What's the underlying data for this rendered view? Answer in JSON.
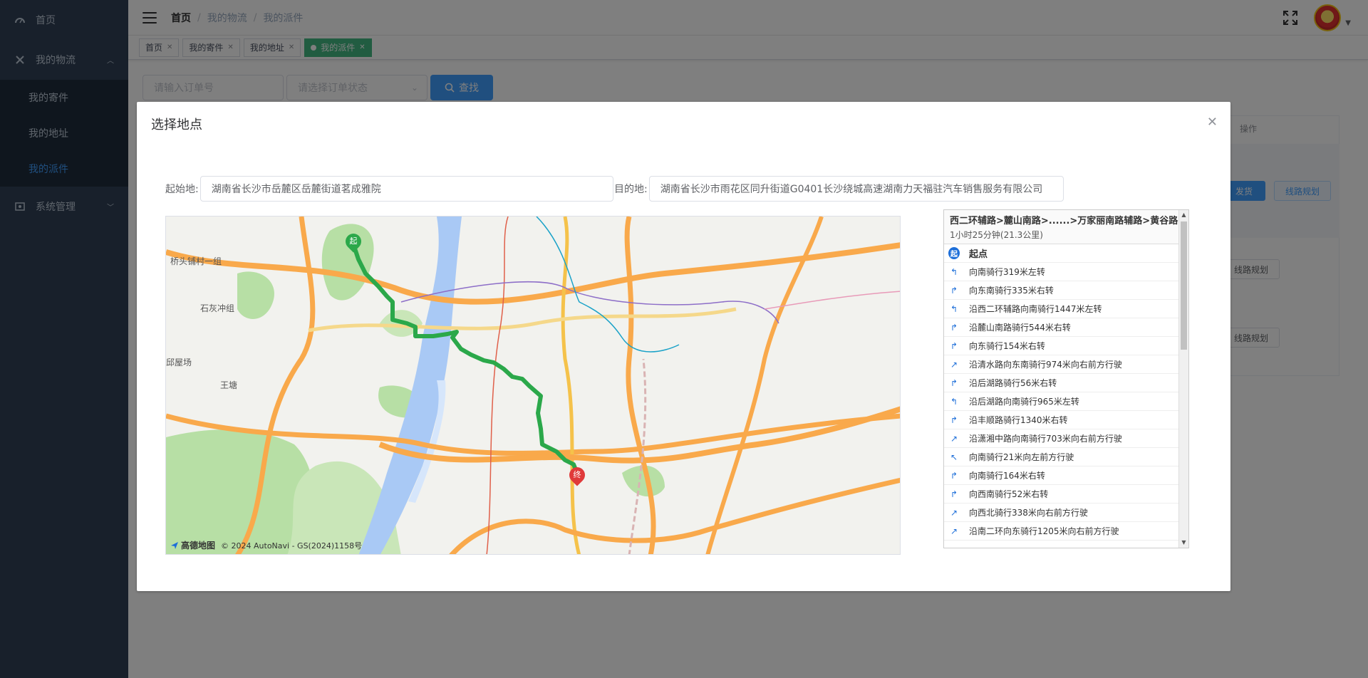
{
  "sidebar": {
    "items": [
      {
        "label": "首页",
        "icon": "dashboard-icon"
      },
      {
        "label": "我的物流",
        "icon": "tools-icon"
      },
      {
        "label": "系统管理",
        "icon": "system-icon"
      }
    ],
    "sub_items": [
      {
        "label": "我的寄件"
      },
      {
        "label": "我的地址"
      },
      {
        "label": "我的派件"
      }
    ]
  },
  "breadcrumb": [
    "首页",
    "我的物流",
    "我的派件"
  ],
  "tags": [
    {
      "label": "首页"
    },
    {
      "label": "我的寄件"
    },
    {
      "label": "我的地址"
    },
    {
      "label": "我的派件"
    }
  ],
  "search": {
    "order_placeholder": "请输入订单号",
    "status_placeholder": "请选择订单状态",
    "button": "查找"
  },
  "table": {
    "op_header": "操作",
    "ship_button": "发货",
    "route_button": "线路规划"
  },
  "dialog": {
    "title": "选择地点",
    "start_label": "起始地:",
    "start_value": "湖南省长沙市岳麓区岳麓街道茗成雅院",
    "dest_label": "目的地:",
    "dest_value": "湖南省长沙市雨花区同升街道G0401长沙绕城高速湖南力天福驻汽车销售服务有限公司"
  },
  "map": {
    "labels": [
      "桥头铺村一组",
      "石灰冲组",
      "邱屋场",
      "王塘"
    ],
    "start_marker": "起",
    "end_marker": "终",
    "logo": "高德地图",
    "copyright": "© 2024 AutoNavi - GS(2024)1158号"
  },
  "route_panel": {
    "route": "西二环辅路>麓山南路>......>万家丽南路辅路>黄谷路",
    "time": "1小时25分钟(21.3公里)",
    "start_icon": "起",
    "steps": [
      {
        "text": "起点",
        "icon": "start"
      },
      {
        "text": "向南骑行319米左转",
        "icon": "left"
      },
      {
        "text": "向东南骑行335米右转",
        "icon": "right"
      },
      {
        "text": "沿西二环辅路向南骑行1447米左转",
        "icon": "left"
      },
      {
        "text": "沿麓山南路骑行544米右转",
        "icon": "right"
      },
      {
        "text": "向东骑行154米右转",
        "icon": "right"
      },
      {
        "text": "沿清水路向东南骑行974米向右前方行驶",
        "icon": "right-front"
      },
      {
        "text": "沿后湖路骑行56米右转",
        "icon": "right"
      },
      {
        "text": "沿后湖路向南骑行965米左转",
        "icon": "left"
      },
      {
        "text": "沿丰顺路骑行1340米右转",
        "icon": "right"
      },
      {
        "text": "沿潇湘中路向南骑行703米向右前方行驶",
        "icon": "right-front"
      },
      {
        "text": "向南骑行21米向左前方行驶",
        "icon": "left-front"
      },
      {
        "text": "向南骑行164米右转",
        "icon": "right"
      },
      {
        "text": "向西南骑行52米右转",
        "icon": "right"
      },
      {
        "text": "向西北骑行338米向右前方行驶",
        "icon": "right-front"
      },
      {
        "text": "沿南二环向东骑行1205米向右前方行驶",
        "icon": "right-front"
      }
    ]
  },
  "colors": {
    "sidebar_bg": "#304156",
    "active_menu": "#409eff",
    "route_green": "#2ba84a",
    "tag_active": "#42b983"
  }
}
